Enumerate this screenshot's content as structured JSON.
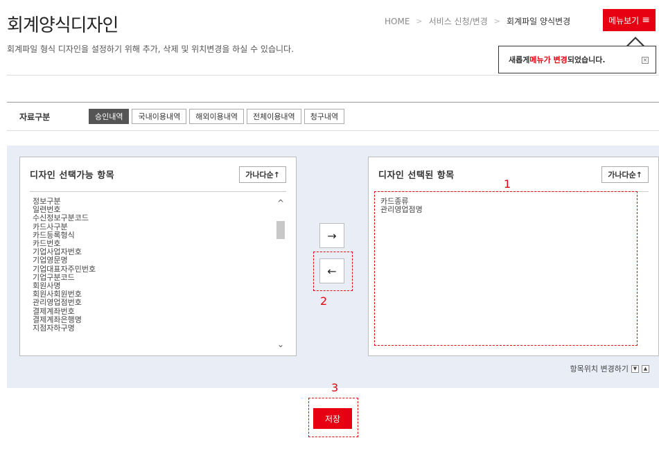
{
  "header": {
    "title": "회계양식디자인",
    "description": "회계파일 형식 디자인을 설정하기 위해 추가, 삭제 및 위치변경을 하실 수 있습니다."
  },
  "breadcrumb": {
    "items": [
      "HOME",
      "서비스 신청/변경",
      "회계파일 양식변경"
    ],
    "separator": ">"
  },
  "menu_button": {
    "label": "메뉴보기",
    "icon": "hamburger-icon"
  },
  "notice": {
    "prefix": "새롭게 ",
    "highlight": "메뉴가 변경",
    "suffix": "되었습니다.",
    "close_label": "×"
  },
  "filter": {
    "label": "자료구분",
    "tabs": [
      "승인내역",
      "국내이용내역",
      "해외이용내역",
      "전체이용내역",
      "청구내역"
    ],
    "active_index": 0
  },
  "available": {
    "title": "디자인 선택가능 항목",
    "sort_label": "가나다순↑",
    "items": [
      "정보구분",
      "일련번호",
      "수신정보구분코드",
      "카드사구분",
      "카드등록형식",
      "카드번호",
      "기업사업자번호",
      "기업영문명",
      "기업대표자주민번호",
      "기업구분코드",
      "회원사명",
      "회원사회원번호",
      "관리영업점번호",
      "결제계좌번호",
      "결제계좌은행명",
      "지점자하구명"
    ]
  },
  "selected": {
    "title": "디자인 선택된 항목",
    "sort_label": "가나다순↑",
    "items": [
      "카드종류",
      "관리영업점명"
    ]
  },
  "transfer": {
    "add_label": "→",
    "remove_label": "←"
  },
  "reorder": {
    "label": "항목위치 변경하기",
    "down_label": "▼",
    "up_label": "▲"
  },
  "save_label": "저장",
  "annotations": [
    "1",
    "2",
    "3"
  ],
  "colors": {
    "accent": "#e60012",
    "panel_bg": "#e9edf6",
    "active_tab": "#555555"
  }
}
